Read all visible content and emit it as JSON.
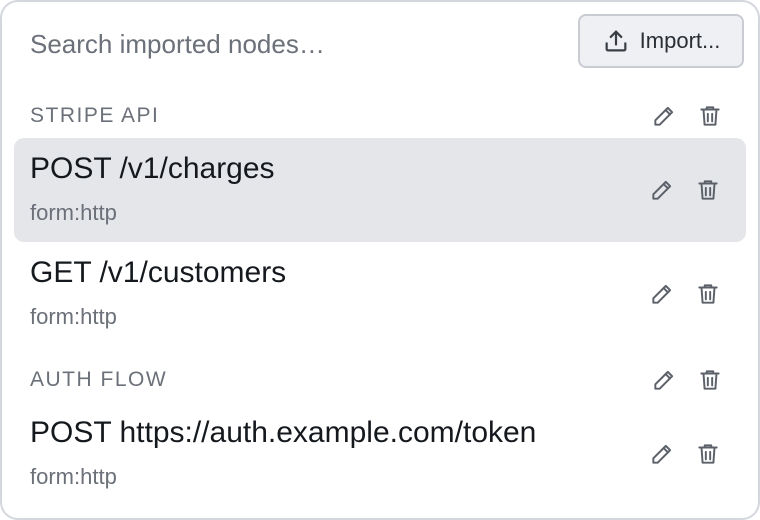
{
  "search": {
    "placeholder": "Search imported nodes…"
  },
  "toolbar": {
    "import_label": "Import..."
  },
  "icons": {
    "upload": "upload-icon",
    "edit": "pencil-icon",
    "delete": "trash-icon"
  },
  "colors": {
    "selected_row_bg": "#e4e6ea",
    "muted_text": "#6b7079",
    "icon_stroke": "#5b6069"
  },
  "groups": [
    {
      "title": "STRIPE API",
      "items": [
        {
          "label": "POST /v1/charges",
          "type": "form:http",
          "selected": true
        },
        {
          "label": "GET /v1/customers",
          "type": "form:http",
          "selected": false
        }
      ]
    },
    {
      "title": "AUTH FLOW",
      "items": [
        {
          "label": "POST https://auth.example.com/token",
          "type": "form:http",
          "selected": false
        }
      ]
    }
  ]
}
